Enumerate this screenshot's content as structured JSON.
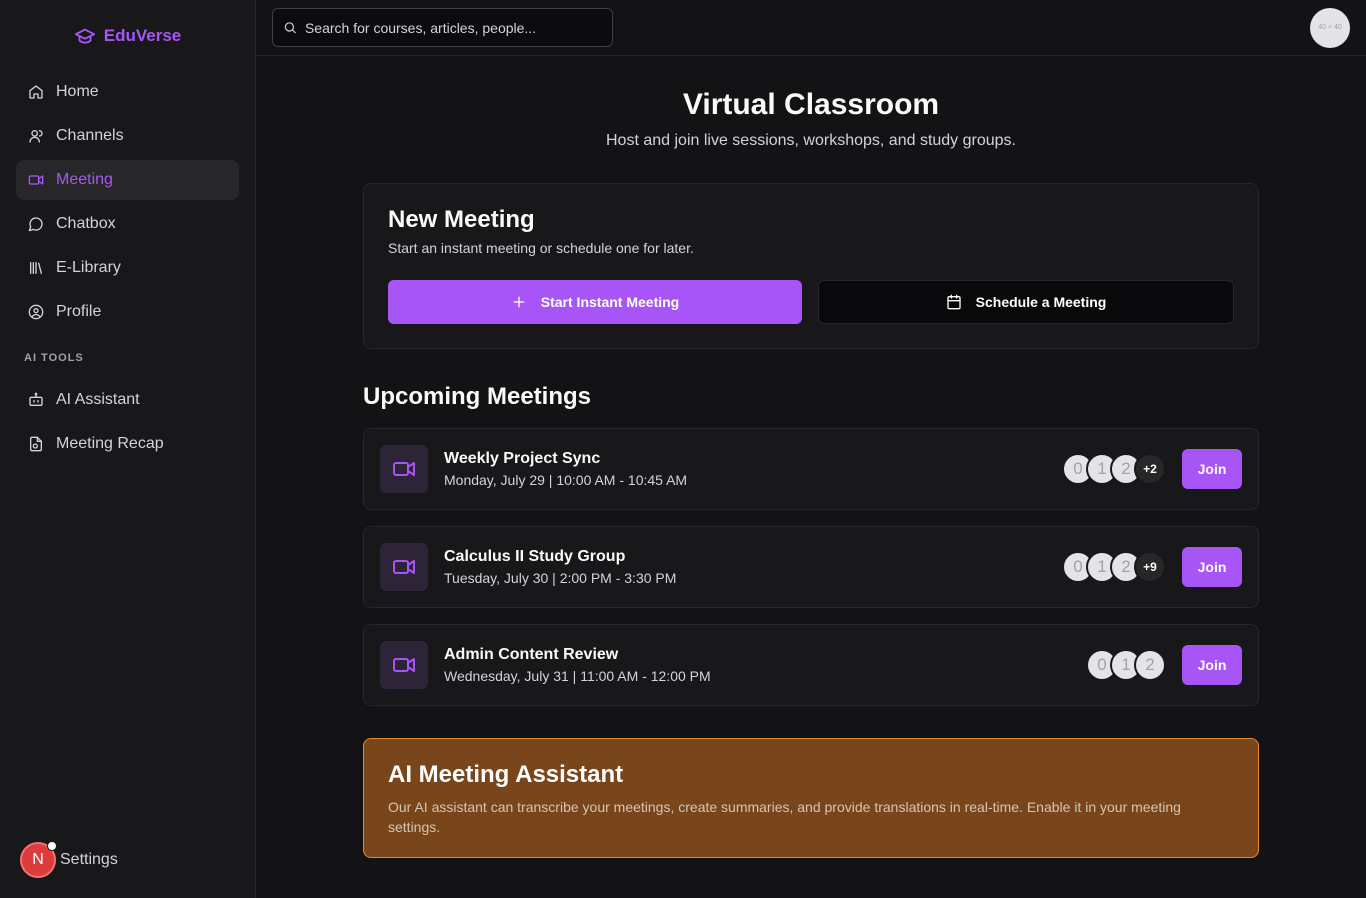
{
  "brand": {
    "name": "EduVerse"
  },
  "sidebar": {
    "items": [
      {
        "label": "Home",
        "icon": "home-icon"
      },
      {
        "label": "Channels",
        "icon": "user-icon"
      },
      {
        "label": "Meeting",
        "icon": "video-icon",
        "active": true
      },
      {
        "label": "Chatbox",
        "icon": "chat-bubble-icon"
      },
      {
        "label": "E-Library",
        "icon": "library-icon"
      },
      {
        "label": "Profile",
        "icon": "user-circle-icon"
      }
    ],
    "section_label": "AI TOOLS",
    "ai_items": [
      {
        "label": "AI Assistant",
        "icon": "bot-icon"
      },
      {
        "label": "Meeting Recap",
        "icon": "file-recap-icon"
      }
    ],
    "settings_label": "Settings",
    "badge_letter": "N"
  },
  "topbar": {
    "search_placeholder": "Search for courses, articles, people...",
    "avatar_text": "40 × 40"
  },
  "header": {
    "title": "Virtual Classroom",
    "subtitle": "Host and join live sessions, workshops, and study groups."
  },
  "new_meeting": {
    "title": "New Meeting",
    "subtitle": "Start an instant meeting or schedule one for later.",
    "start_label": "Start Instant Meeting",
    "schedule_label": "Schedule a Meeting"
  },
  "upcoming": {
    "title": "Upcoming Meetings",
    "join_label": "Join",
    "meetings": [
      {
        "title": "Weekly Project Sync",
        "time": "Monday, July 29 | 10:00 AM - 10:45 AM",
        "avatars": [
          "0",
          "1",
          "2"
        ],
        "more": "+2"
      },
      {
        "title": "Calculus II Study Group",
        "time": "Tuesday, July 30 | 2:00 PM - 3:30 PM",
        "avatars": [
          "0",
          "1",
          "2"
        ],
        "more": "+9"
      },
      {
        "title": "Admin Content Review",
        "time": "Wednesday, July 31 | 11:00 AM - 12:00 PM",
        "avatars": [
          "0",
          "1",
          "2"
        ],
        "more": ""
      }
    ]
  },
  "ai_assistant": {
    "title": "AI Meeting Assistant",
    "text": "Our AI assistant can transcribe your meetings, create summaries, and provide translations in real-time. Enable it in your meeting settings."
  },
  "colors": {
    "accent": "#a855f7",
    "ai_card_bg": "#78461a",
    "ai_card_border": "#e88a2d",
    "badge": "#dc3c3c"
  }
}
